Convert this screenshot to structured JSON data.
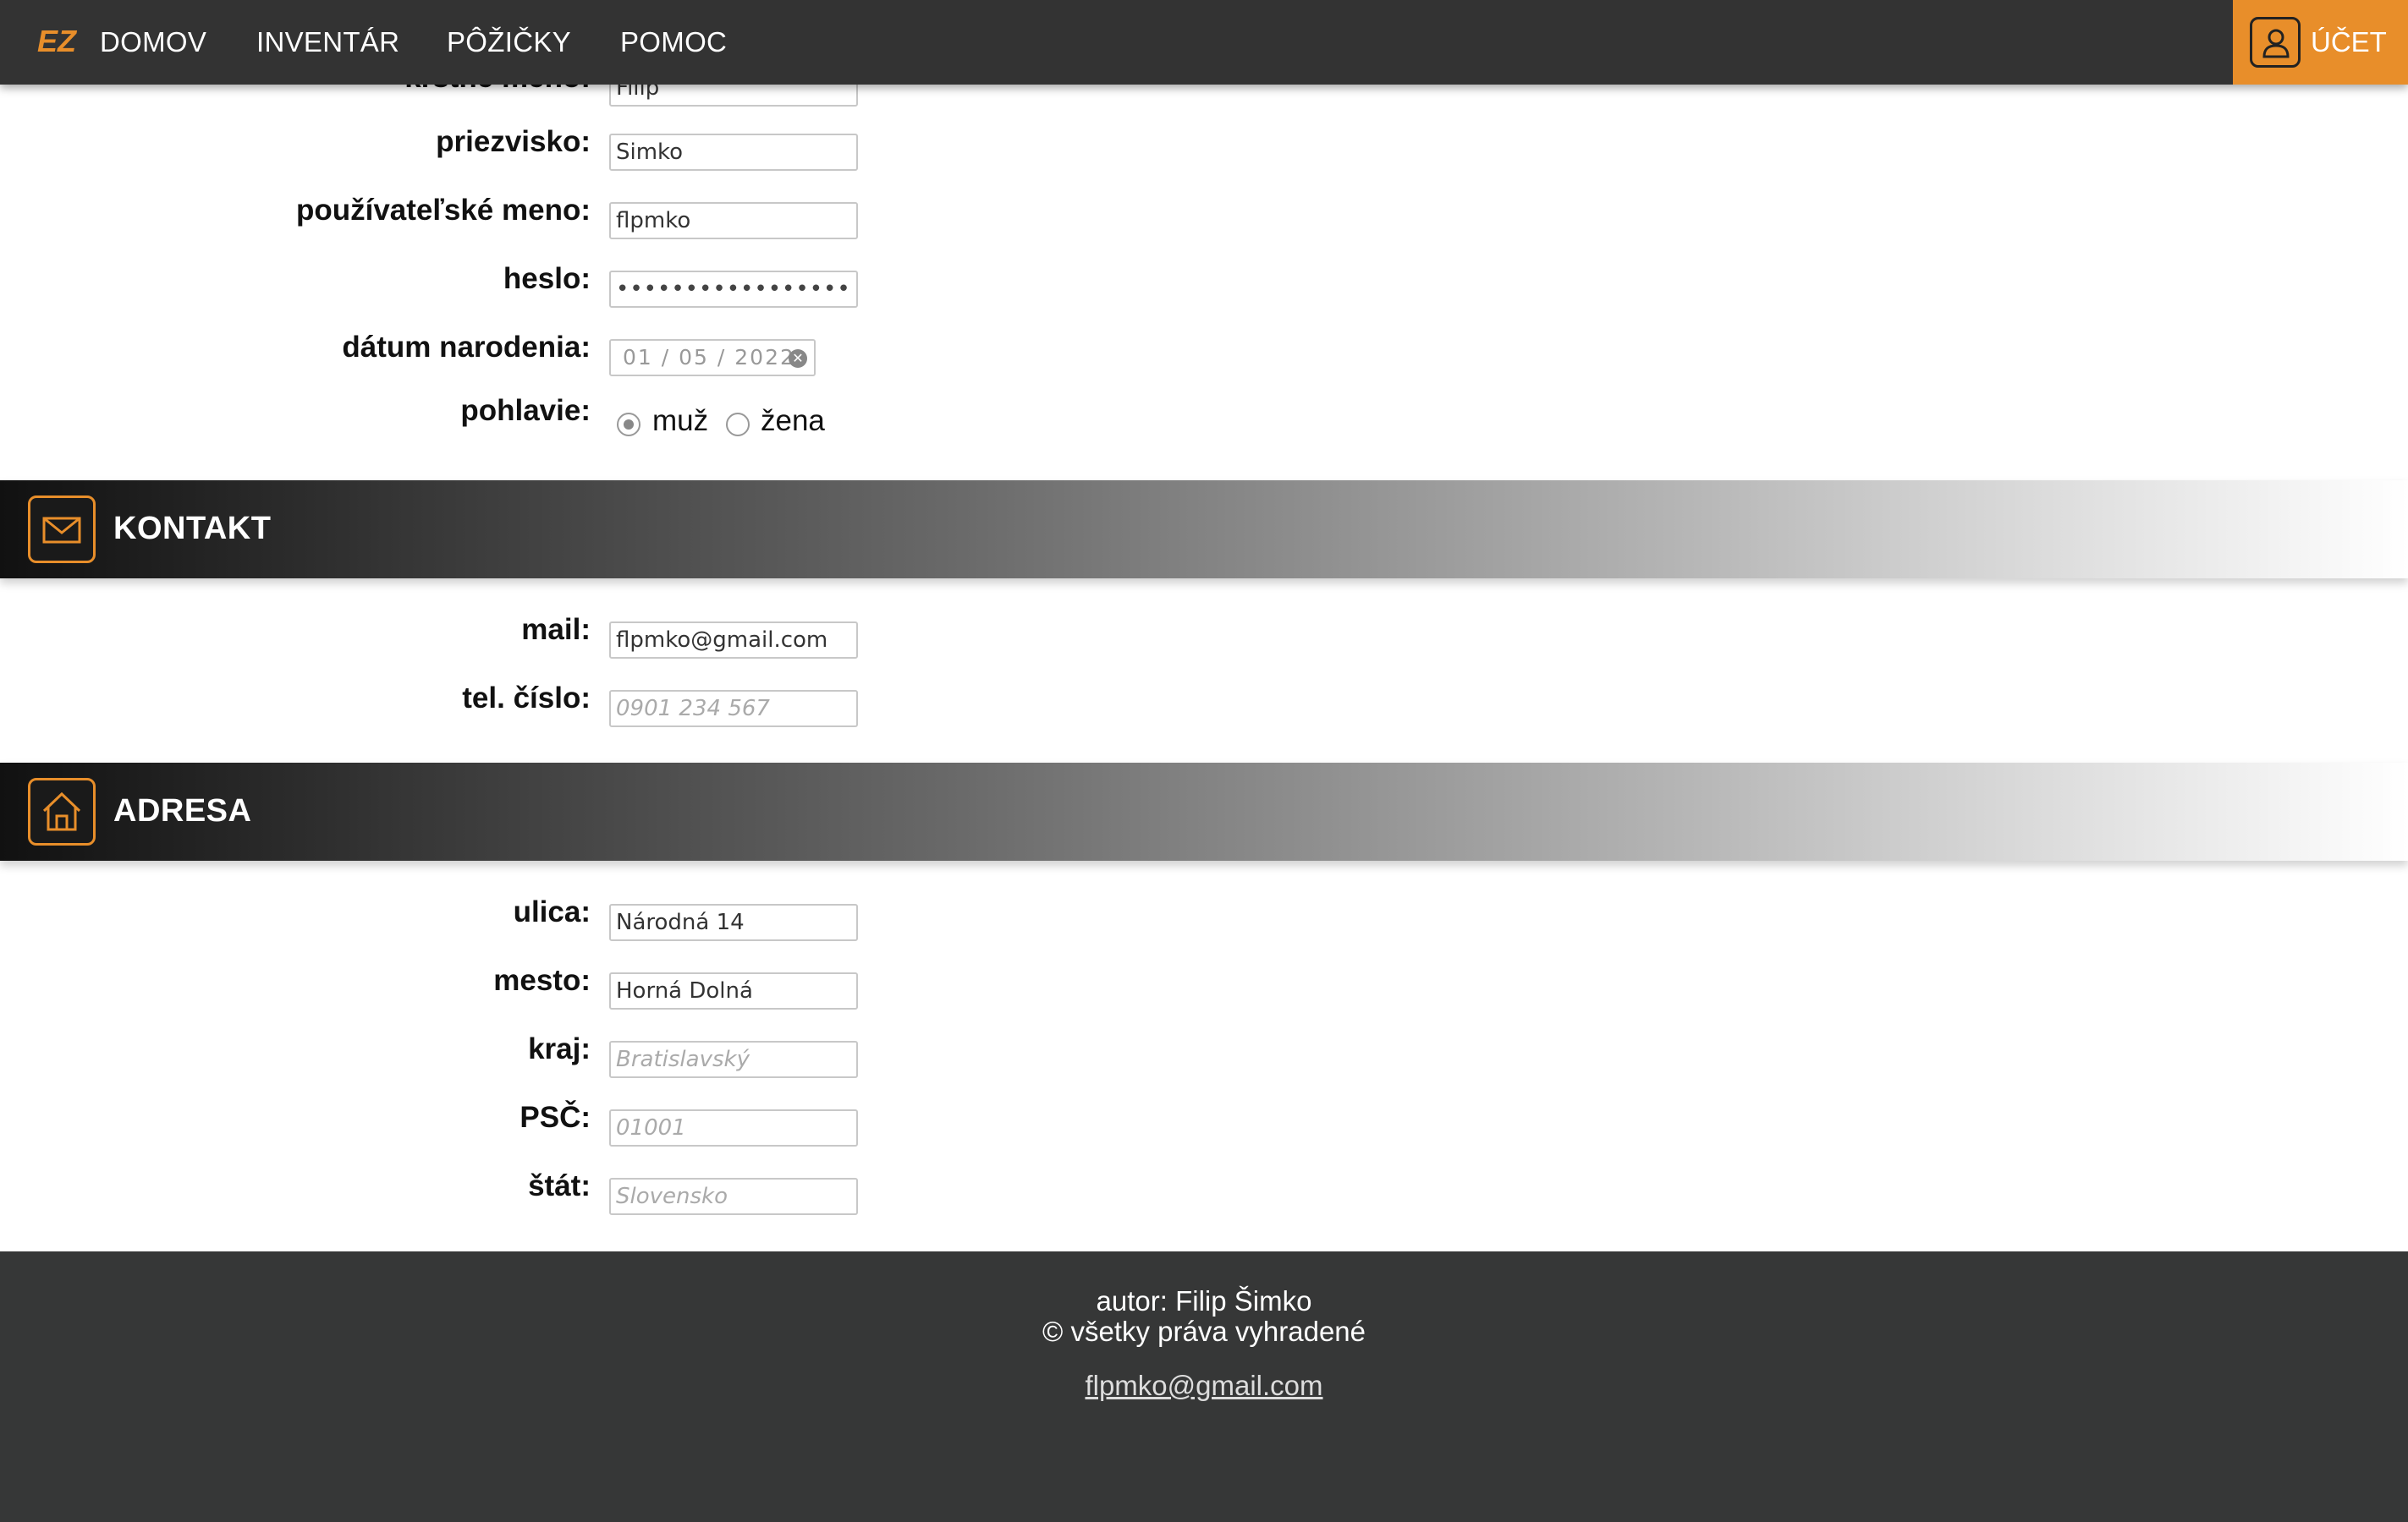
{
  "nav": {
    "logo_text": "EZ",
    "items": [
      "DOMOV",
      "INVENTÁR",
      "PÔŽIČKY",
      "POMOC"
    ],
    "account_label": "ÚČET"
  },
  "personal": {
    "first_name_label": "krstné meno:",
    "first_name_value": "Filip",
    "last_name_label": "priezvisko:",
    "last_name_value": "Simko",
    "username_label": "používateľské meno:",
    "username_value": "flpmko",
    "password_label": "heslo:",
    "password_value": "•••••••••••••••••",
    "birth_label": "dátum narodenia:",
    "birth_value": "01 / 05 / 2022",
    "gender_label": "pohlavie:",
    "gender_options": [
      "muž",
      "žena"
    ],
    "gender_selected": "muž"
  },
  "contact": {
    "title": "KONTAKT",
    "mail_label": "mail:",
    "mail_value": "flpmko@gmail.com",
    "phone_label": "tel. číslo:",
    "phone_placeholder": "0901 234 567"
  },
  "address": {
    "title": "ADRESA",
    "street_label": "ulica:",
    "street_value": "Národná 14",
    "city_label": "mesto:",
    "city_value": "Horná Dolná",
    "region_label": "kraj:",
    "region_placeholder": "Bratislavský",
    "zip_label": "PSČ:",
    "zip_placeholder": "01001",
    "country_label": "štát:",
    "country_placeholder": "Slovensko"
  },
  "footer": {
    "author": "autor: Filip Šimko",
    "rights": "© všetky práva vyhradené",
    "email": "flpmko@gmail.com"
  },
  "colors": {
    "accent": "#e88e2a",
    "nav_bg": "#333333",
    "footer_bg": "#363737"
  },
  "icons": {
    "account": "user-icon",
    "contact": "envelope-icon",
    "address": "house-icon"
  }
}
